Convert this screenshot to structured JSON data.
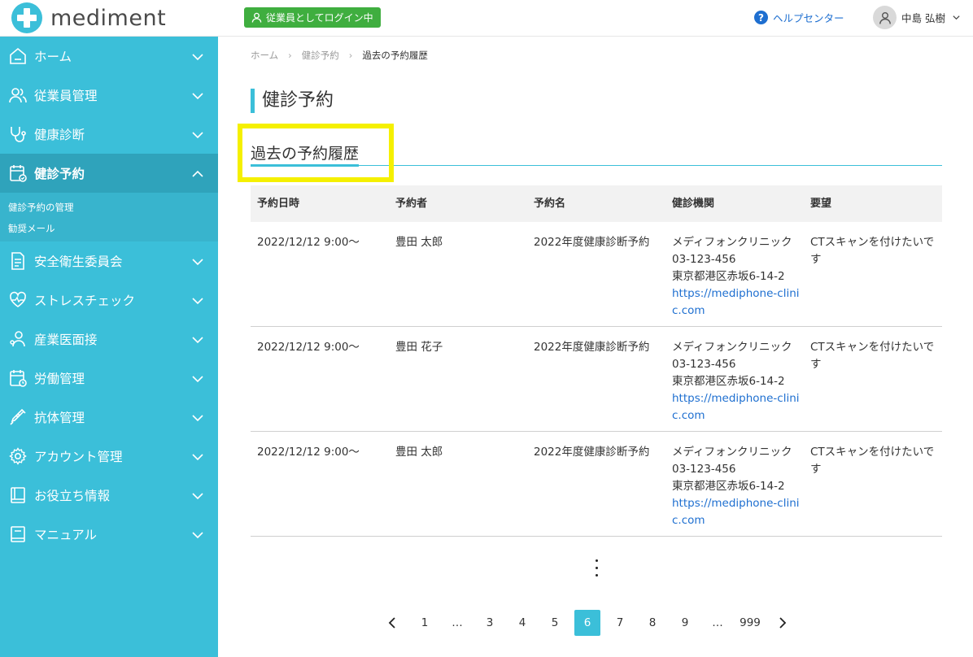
{
  "header": {
    "logo_text": "mediment",
    "login_badge": "従業員としてログイン中",
    "help_label": "ヘルプセンター",
    "user_name": "中島 弘樹"
  },
  "sidebar": {
    "items": [
      {
        "label": "ホーム",
        "icon": "home-icon"
      },
      {
        "label": "従業員管理",
        "icon": "users-icon"
      },
      {
        "label": "健康診断",
        "icon": "stethoscope-icon"
      },
      {
        "label": "健診予約",
        "icon": "calendar-check-icon",
        "active": true
      },
      {
        "label": "安全衛生委員会",
        "icon": "document-icon"
      },
      {
        "label": "ストレスチェック",
        "icon": "heart-icon"
      },
      {
        "label": "産業医面接",
        "icon": "doctor-icon"
      },
      {
        "label": "労働管理",
        "icon": "calendar-clock-icon"
      },
      {
        "label": "抗体管理",
        "icon": "syringe-icon"
      },
      {
        "label": "アカウント管理",
        "icon": "gear-icon"
      },
      {
        "label": "お役立ち情報",
        "icon": "book-icon"
      },
      {
        "label": "マニュアル",
        "icon": "manual-icon"
      }
    ],
    "subitems": [
      "健診予約の管理",
      "勧奨メール"
    ]
  },
  "breadcrumb": {
    "home": "ホーム",
    "parent": "健診予約",
    "current": "過去の予約履歴"
  },
  "page": {
    "title": "健診予約",
    "section_title": "過去の予約履歴"
  },
  "table": {
    "headers": [
      "予約日時",
      "予約者",
      "予約名",
      "健診機関",
      "要望"
    ],
    "rows": [
      {
        "datetime": "2022/12/12 9:00〜",
        "person": "豊田 太郎",
        "name": "2022年度健康診断予約",
        "clinic": "メディフォンクリニック",
        "phone": "03-123-456",
        "address": "東京都港区赤坂6-14-2",
        "url": "https://mediphone-clinic.com",
        "request": "CTスキャンを付けたいです"
      },
      {
        "datetime": "2022/12/12 9:00〜",
        "person": "豊田 花子",
        "name": "2022年度健康診断予約",
        "clinic": "メディフォンクリニック",
        "phone": "03-123-456",
        "address": "東京都港区赤坂6-14-2",
        "url": "https://mediphone-clinic.com",
        "request": "CTスキャンを付けたいです"
      },
      {
        "datetime": "2022/12/12 9:00〜",
        "person": "豊田 太郎",
        "name": "2022年度健康診断予約",
        "clinic": "メディフォンクリニック",
        "phone": "03-123-456",
        "address": "東京都港区赤坂6-14-2",
        "url": "https://mediphone-clinic.com",
        "request": "CTスキャンを付けたいです"
      }
    ]
  },
  "pagination": {
    "pages": [
      "1",
      "…",
      "3",
      "4",
      "5",
      "6",
      "7",
      "8",
      "9",
      "…",
      "999"
    ],
    "current": "6"
  },
  "colors": {
    "accent": "#3bbfd9",
    "active_nav": "#2fa3bb",
    "badge_green": "#3fae3f",
    "link": "#1e6fd0",
    "highlight": "#f5f000"
  }
}
